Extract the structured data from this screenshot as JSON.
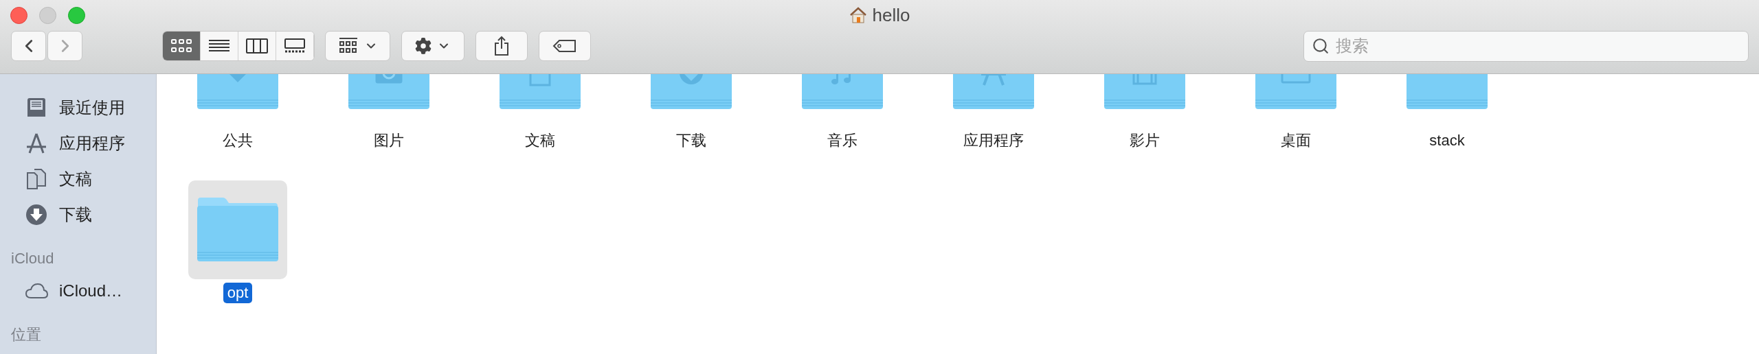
{
  "window": {
    "title": "hello"
  },
  "toolbar": {
    "nav": [
      {
        "kind": "back",
        "disabled": false
      },
      {
        "kind": "forward",
        "disabled": true
      }
    ],
    "view_modes": [
      {
        "kind": "icons",
        "selected": true
      },
      {
        "kind": "list",
        "selected": false
      },
      {
        "kind": "columns",
        "selected": false
      },
      {
        "kind": "gallery",
        "selected": false
      }
    ],
    "buttons": [
      {
        "kind": "arrange"
      },
      {
        "kind": "action"
      },
      {
        "kind": "share"
      },
      {
        "kind": "tags"
      }
    ],
    "search": {
      "placeholder": "搜索"
    }
  },
  "sidebar": {
    "sections": [
      {
        "items": [
          {
            "kind": "recent",
            "label": "最近使用"
          },
          {
            "kind": "apps",
            "label": "应用程序"
          },
          {
            "kind": "documents",
            "label": "文稿"
          },
          {
            "kind": "downloads",
            "label": "下载"
          }
        ]
      },
      {
        "header": "iCloud",
        "items": [
          {
            "kind": "cloud",
            "label": "iCloud…"
          }
        ]
      },
      {
        "header": "位置"
      }
    ]
  },
  "files": [
    {
      "name": "公共",
      "kind": "public",
      "selected": false
    },
    {
      "name": "图片",
      "kind": "pictures",
      "selected": false
    },
    {
      "name": "文稿",
      "kind": "documents",
      "selected": false
    },
    {
      "name": "下载",
      "kind": "downloads",
      "selected": false
    },
    {
      "name": "音乐",
      "kind": "music",
      "selected": false
    },
    {
      "name": "应用程序",
      "kind": "apps",
      "selected": false
    },
    {
      "name": "影片",
      "kind": "movies",
      "selected": false
    },
    {
      "name": "桌面",
      "kind": "desktop",
      "selected": false
    },
    {
      "name": "stack",
      "kind": "plain",
      "selected": false
    },
    {
      "name": "opt",
      "kind": "plain",
      "selected": true
    }
  ]
}
